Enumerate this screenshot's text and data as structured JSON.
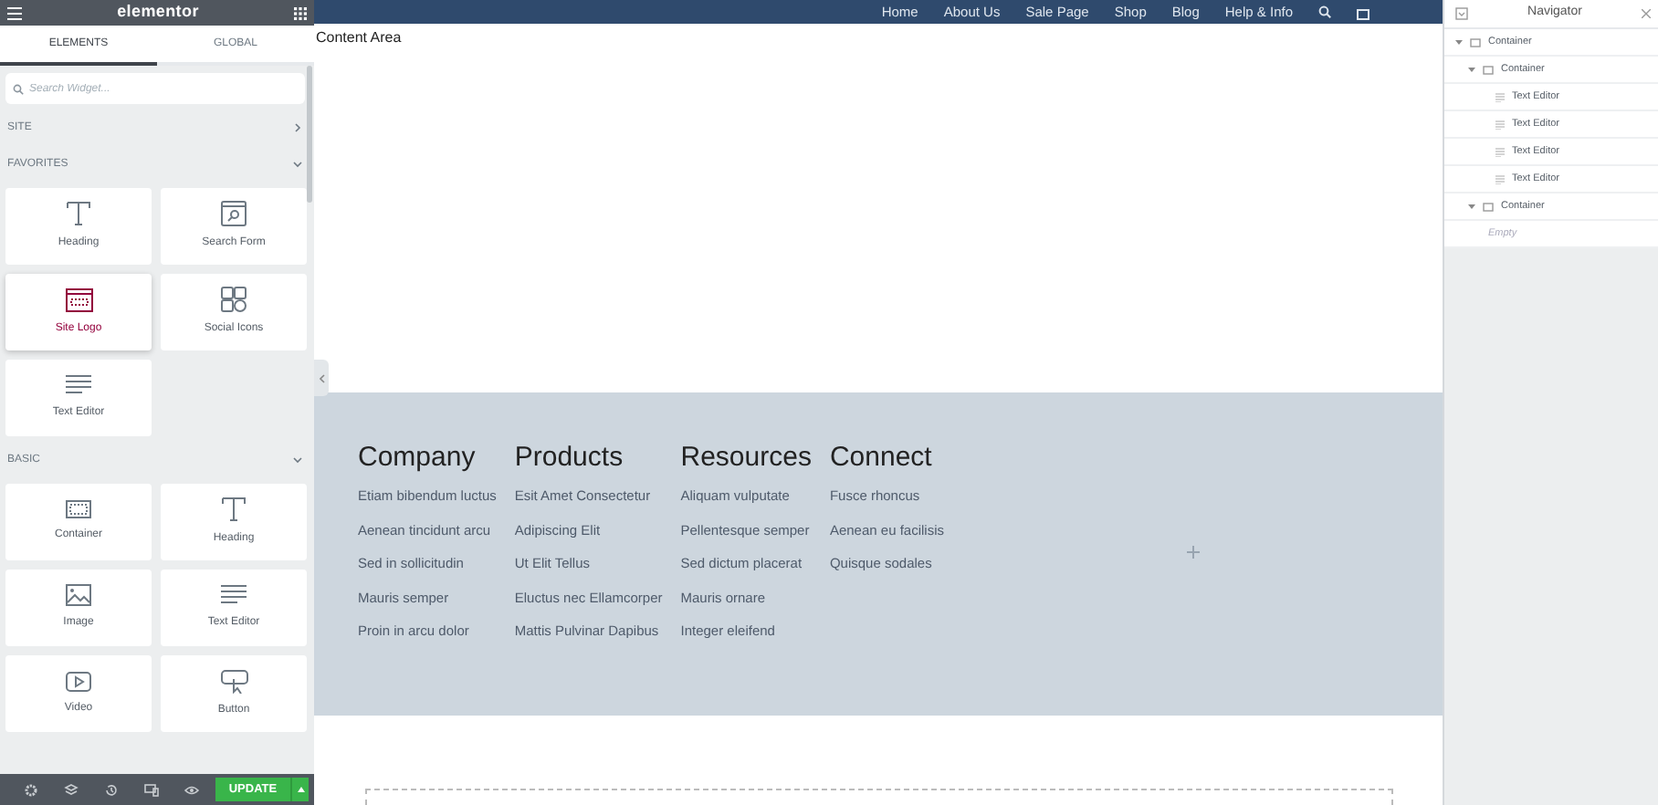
{
  "panel": {
    "title": "elementor",
    "tabs": [
      {
        "label": "ELEMENTS",
        "selected": true
      },
      {
        "label": "GLOBAL",
        "selected": false
      }
    ],
    "search": {
      "placeholder": "Search Widget..."
    },
    "sections": [
      {
        "title": "SITE",
        "expanded": false
      },
      {
        "title": "FAVORITES",
        "expanded": true,
        "widgets": [
          {
            "label": "Heading",
            "highlighted": false
          },
          {
            "label": "Search Form",
            "highlighted": false
          },
          {
            "label": "Site Logo",
            "highlighted": true
          },
          {
            "label": "Social Icons",
            "highlighted": false
          },
          {
            "label": "Text Editor",
            "highlighted": false
          }
        ]
      },
      {
        "title": "BASIC",
        "expanded": true,
        "widgets": [
          {
            "label": "Container",
            "highlighted": false
          },
          {
            "label": "Heading",
            "highlighted": false
          },
          {
            "label": "Image",
            "highlighted": false
          },
          {
            "label": "Text Editor",
            "highlighted": false
          },
          {
            "label": "Video",
            "highlighted": false
          },
          {
            "label": "Button",
            "highlighted": false
          }
        ]
      }
    ],
    "update_button": "UPDATE"
  },
  "site_nav": [
    "Home",
    "About Us",
    "Sale Page",
    "Shop",
    "Blog",
    "Help & Info"
  ],
  "content_label": "Content Area",
  "footer": {
    "columns": [
      {
        "heading": "Company",
        "links": [
          "Etiam bibendum luctus",
          "Aenean tincidunt arcu",
          "Sed in sollicitudin",
          "Mauris semper",
          "Proin in arcu dolor"
        ]
      },
      {
        "heading": "Products",
        "links": [
          "Esit Amet Consectetur",
          "Adipiscing Elit",
          "Ut Elit Tellus",
          "Eluctus nec Ellamcorper",
          "Mattis Pulvinar Dapibus"
        ]
      },
      {
        "heading": "Resources",
        "links": [
          "Aliquam vulputate",
          "Pellentesque semper",
          "Sed dictum placerat",
          "Mauris ornare",
          "Integer eleifend"
        ]
      },
      {
        "heading": "Connect",
        "links": [
          "Fusce rhoncus",
          "Aenean eu facilisis",
          "Quisque sodales"
        ]
      }
    ]
  },
  "navigator": {
    "title": "Navigator",
    "items": [
      {
        "label": "Container",
        "kind": "container",
        "expanded": true,
        "children": [
          {
            "label": "Container",
            "kind": "container",
            "expanded": true,
            "children": [
              {
                "label": "Text Editor",
                "kind": "widget"
              },
              {
                "label": "Text Editor",
                "kind": "widget"
              },
              {
                "label": "Text Editor",
                "kind": "widget"
              },
              {
                "label": "Text Editor",
                "kind": "widget"
              }
            ]
          },
          {
            "label": "Container",
            "kind": "container",
            "expanded": true,
            "children": [
              {
                "label": "Empty",
                "kind": "empty"
              }
            ]
          }
        ]
      }
    ]
  }
}
